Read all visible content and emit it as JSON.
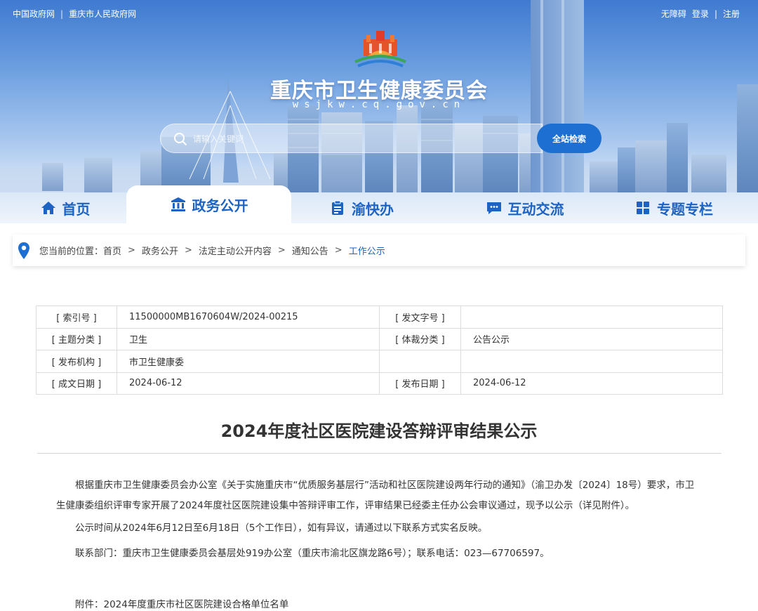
{
  "topbar": {
    "left_links": [
      "中国政府网",
      "重庆市人民政府网"
    ],
    "separator": "|",
    "accessibility": "无障碍",
    "login": "登录",
    "register": "注册"
  },
  "header": {
    "title": "重庆市卫生健康委员会",
    "domain": "wsjkw.cq.gov.cn"
  },
  "search": {
    "placeholder": "请输入关键词",
    "button_label": "全站检索"
  },
  "nav": {
    "items": [
      {
        "label": "首页",
        "icon": "home-icon"
      },
      {
        "label": "政务公开",
        "icon": "bank-icon"
      },
      {
        "label": "渝快办",
        "icon": "clipboard-icon"
      },
      {
        "label": "互动交流",
        "icon": "chat-icon"
      },
      {
        "label": "专题专栏",
        "icon": "grid-icon"
      }
    ],
    "active_index": 1
  },
  "breadcrumb": {
    "prefix": "您当前的位置：",
    "items": [
      "首页",
      "政务公开",
      "法定主动公开内容",
      "通知公告",
      "工作公示"
    ],
    "separator": ">"
  },
  "meta": {
    "index_label": "[ 索引号 ]",
    "index_value": "11500000MB1670604W/2024-00215",
    "doc_no_label": "[ 发文字号 ]",
    "doc_no_value": "",
    "topic_label": "[ 主题分类 ]",
    "topic_value": "卫生",
    "genre_label": "[ 体裁分类 ]",
    "genre_value": "公告公示",
    "publisher_label": "[ 发布机构 ]",
    "publisher_value": "市卫生健康委",
    "created_label": "[ 成文日期 ]",
    "created_value": "2024-06-12",
    "published_label": "[ 发布日期 ]",
    "published_value": "2024-06-12"
  },
  "article": {
    "title": "2024年度社区医院建设答辩评审结果公示",
    "paragraphs": [
      "根据重庆市卫生健康委员会办公室《关于实施重庆市“优质服务基层行”活动和社区医院建设两年行动的通知》（渝卫办发〔2024〕18号）要求，市卫生健康委组织评审专家开展了2024年度社区医院建设集中答辩评审工作，评审结果已经委主任办公会审议通过，现予以公示（详见附件）。",
      "公示时间从2024年6月12日至6月18日（5个工作日），如有异议，请通过以下联系方式实名反映。",
      "联系部门：重庆市卫生健康委员会基层处919办公室（重庆市渝北区旗龙路6号）；联系电话：023—67706597。",
      "附件：2024年度重庆市社区医院建设合格单位名单"
    ]
  },
  "colors": {
    "primary_blue": "#1d63c4",
    "search_button": "#1d6fd1",
    "banner_top": "#3f7ad0"
  }
}
